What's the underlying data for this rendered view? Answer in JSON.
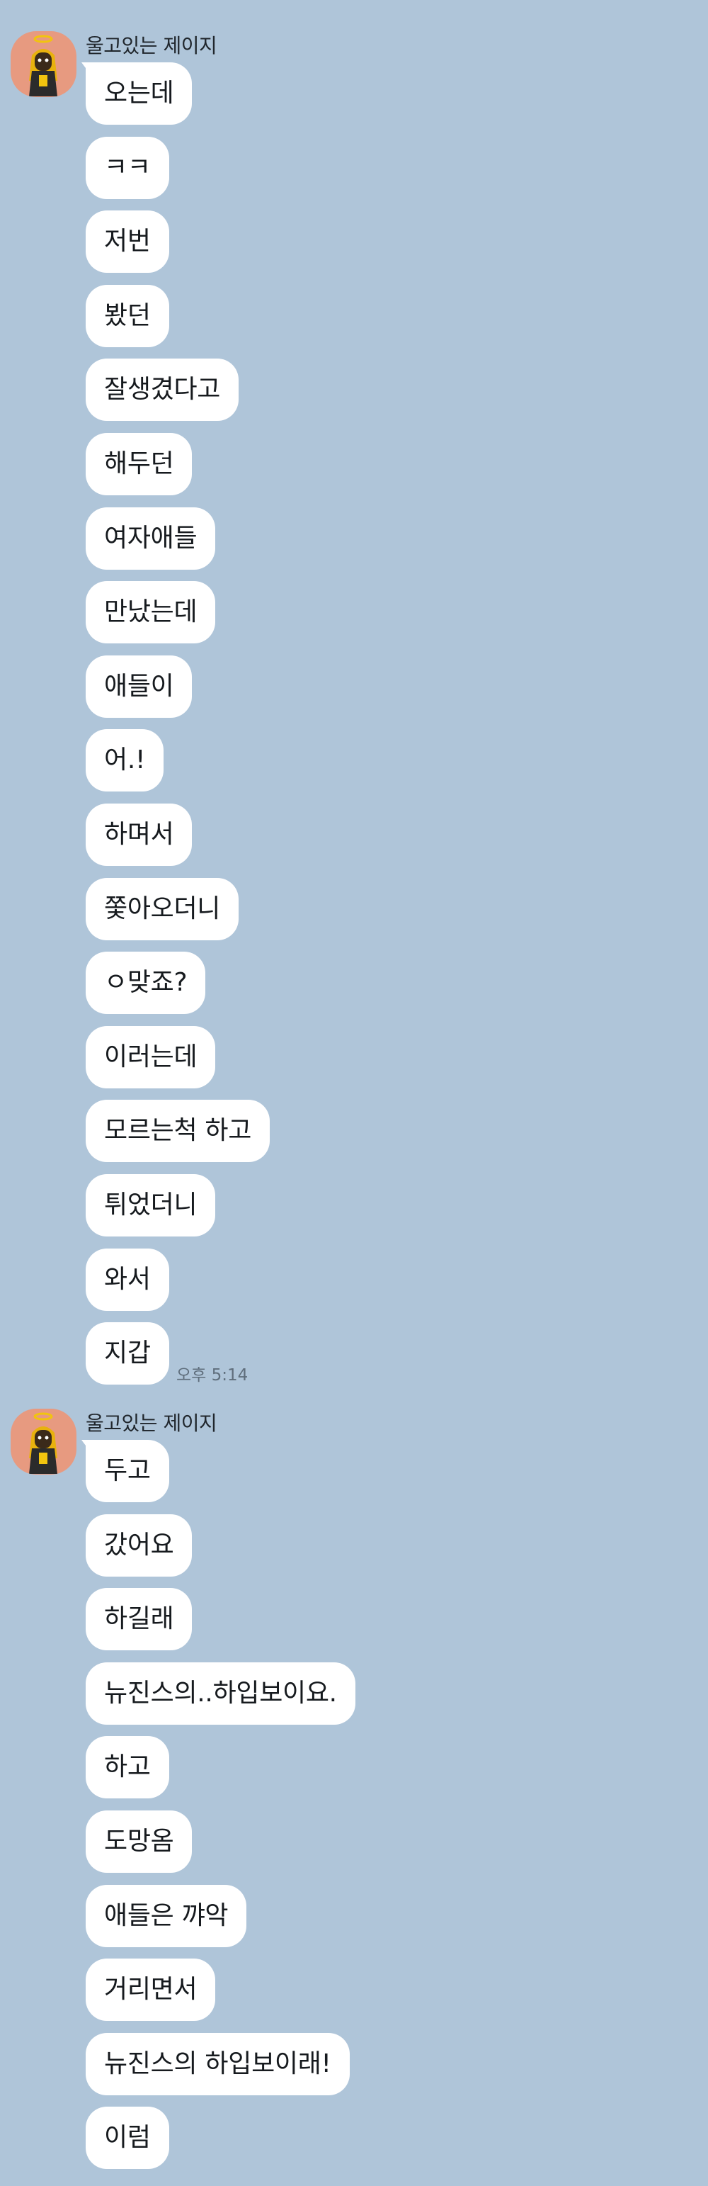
{
  "conversation": {
    "groups": [
      {
        "sender": "울고있는 제이지",
        "messages": [
          "오는데",
          "ㅋㅋ",
          "저번",
          "봤던",
          "잘생겼다고",
          "해두던",
          "여자애들",
          "만났는데",
          "애들이",
          "어.!",
          "하며서",
          "쫓아오더니",
          "ㅇ맞죠?",
          "이러는데",
          "모르는척 하고",
          "튀었더니",
          "와서",
          "지갑"
        ],
        "time": "오후 5:14"
      },
      {
        "sender": "울고있는 제이지",
        "messages": [
          "두고",
          "갔어요",
          "하길래",
          "뉴진스의..하입보이요.",
          "하고",
          "도망옴",
          "애들은 꺄악",
          "거리면서",
          "뉴진스의 하입보이래!",
          "이럼"
        ],
        "time": ""
      }
    ]
  },
  "colors": {
    "background": "#afc5d9",
    "bubble": "#ffffff",
    "avatar_bg": "#e79a80",
    "text": "#161a1e",
    "timestamp": "#5f6e7c"
  },
  "icons": {
    "avatar": "character-avatar-icon"
  }
}
